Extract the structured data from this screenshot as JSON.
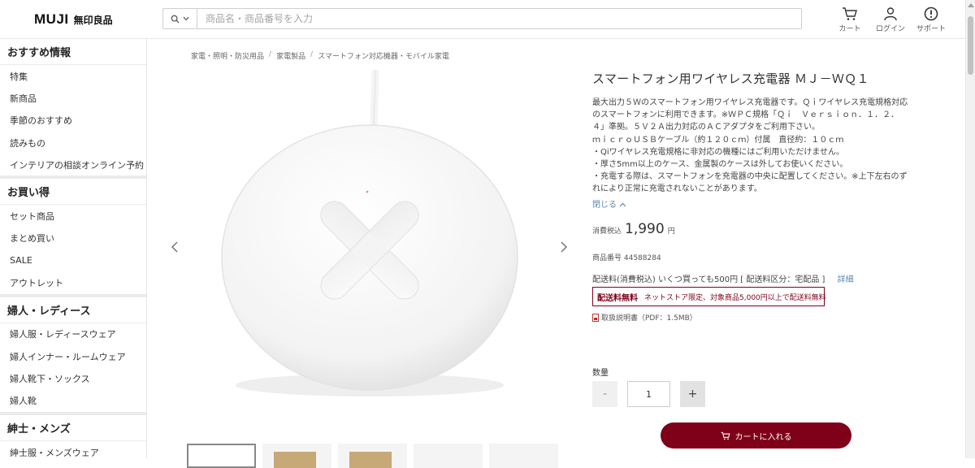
{
  "header": {
    "logo_en": "MUJI",
    "logo_jp": "無印良品",
    "search_placeholder": "商品名・商品番号を入力",
    "cart_label": "カート",
    "login_label": "ログイン",
    "support_label": "サポート"
  },
  "sidebar": {
    "sections": [
      {
        "title": "おすすめ情報",
        "items": [
          "特集",
          "新商品",
          "季節のおすすめ",
          "読みもの",
          "インテリアの相談オンライン予約"
        ]
      },
      {
        "title": "お買い得",
        "items": [
          "セット商品",
          "まとめ買い",
          "SALE",
          "アウトレット"
        ]
      },
      {
        "title": "婦人・レディース",
        "items": [
          "婦人服・レディースウェア",
          "婦人インナー・ルームウェア",
          "婦人靴下・ソックス",
          "婦人靴"
        ]
      },
      {
        "title": "紳士・メンズ",
        "items": [
          "紳士服・メンズウェア"
        ]
      }
    ]
  },
  "breadcrumb": [
    "家電・照明・防災用品",
    "家電製品",
    "スマートフォン対応機器・モバイル家電"
  ],
  "product": {
    "title": "スマートフォン用ワイヤレス充電器 ＭＪ－ＷＱ１",
    "description": [
      "最大出力５Ｗのスマートフォン用ワイヤレス充電器です。Ｑｉワイヤレス充電規格対応",
      "のスマートフォンに利用できます。※ＷＰＣ規格「Ｑｉ　Ｖｅｒｓｉｏｎ．１．２．",
      "４」準拠。５Ｖ２Ａ出力対応のＡＣアダプタをご利用下さい。",
      "ｍｉｃｒｏＵＳＢケーブル（約１２０ｃｍ）付属　直径約：１０ｃｍ",
      "・Qiワイヤレス充電規格に非対応の機種にはご利用いただけません。",
      "・厚さ5mm以上のケース、金属製のケースは外してお使いください。",
      "・充電する際は、スマートフォンを充電器の中央に配置してください。※上下左右のず",
      "れにより正常に充電されないことがあります。"
    ],
    "close_label": "閉じる",
    "tax_label": "消費税込",
    "price": "1,990",
    "currency": "円",
    "product_number": "商品番号 44588284",
    "shipping": "配送料(消費税込)  いくつ買っても500円 [ 配送料区分：宅配品 ]",
    "shipping_detail_link": "詳細",
    "free_shipping_badge": "配送料無料",
    "free_shipping_note": "ネットストア限定、対象商品5,000円以上で配送料無料",
    "manual_label": "取扱説明書（PDF：1.5MB）",
    "quantity_label": "数量",
    "quantity_value": "1",
    "minus": "-",
    "plus": "+",
    "add_to_cart": "カートに入れる"
  },
  "colors": {
    "accent": "#7f0019",
    "link": "#5b8bb5"
  }
}
